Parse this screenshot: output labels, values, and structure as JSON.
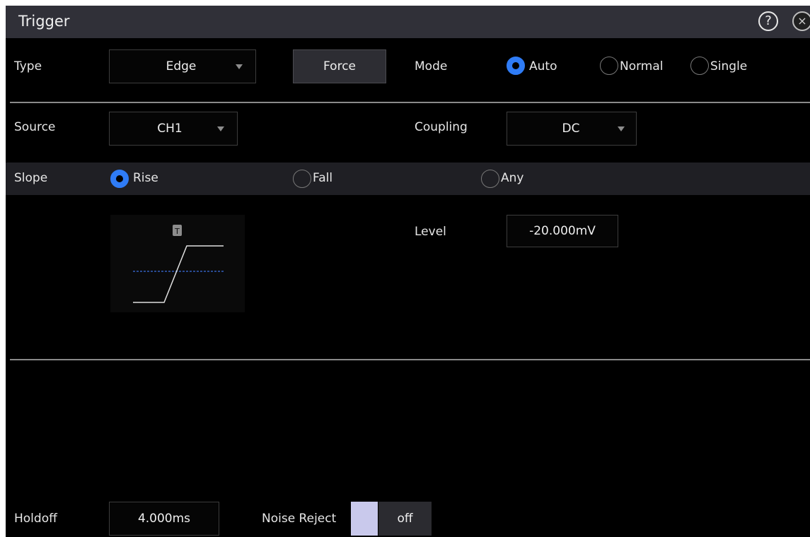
{
  "dialog": {
    "title": "Trigger"
  },
  "type": {
    "label": "Type",
    "value": "Edge"
  },
  "force": {
    "label": "Force"
  },
  "mode": {
    "label": "Mode",
    "options": [
      "Auto",
      "Normal",
      "Single"
    ],
    "selected": "Auto"
  },
  "source": {
    "label": "Source",
    "value": "CH1"
  },
  "coupling": {
    "label": "Coupling",
    "value": "DC"
  },
  "slope": {
    "label": "Slope",
    "options": [
      "Rise",
      "Fall",
      "Any"
    ],
    "selected": "Rise"
  },
  "diagram": {
    "marker": "T"
  },
  "level": {
    "label": "Level",
    "value": "-20.000mV"
  },
  "holdoff": {
    "label": "Holdoff",
    "value": "4.000ms"
  },
  "noise_reject": {
    "label": "Noise Reject",
    "value": "off"
  },
  "icons": {
    "help": "?",
    "close": "×"
  },
  "colors": {
    "accent": "#2f7cf6",
    "level_line": "#3b6fe0",
    "noise_swatch": "#c9c9ec"
  }
}
